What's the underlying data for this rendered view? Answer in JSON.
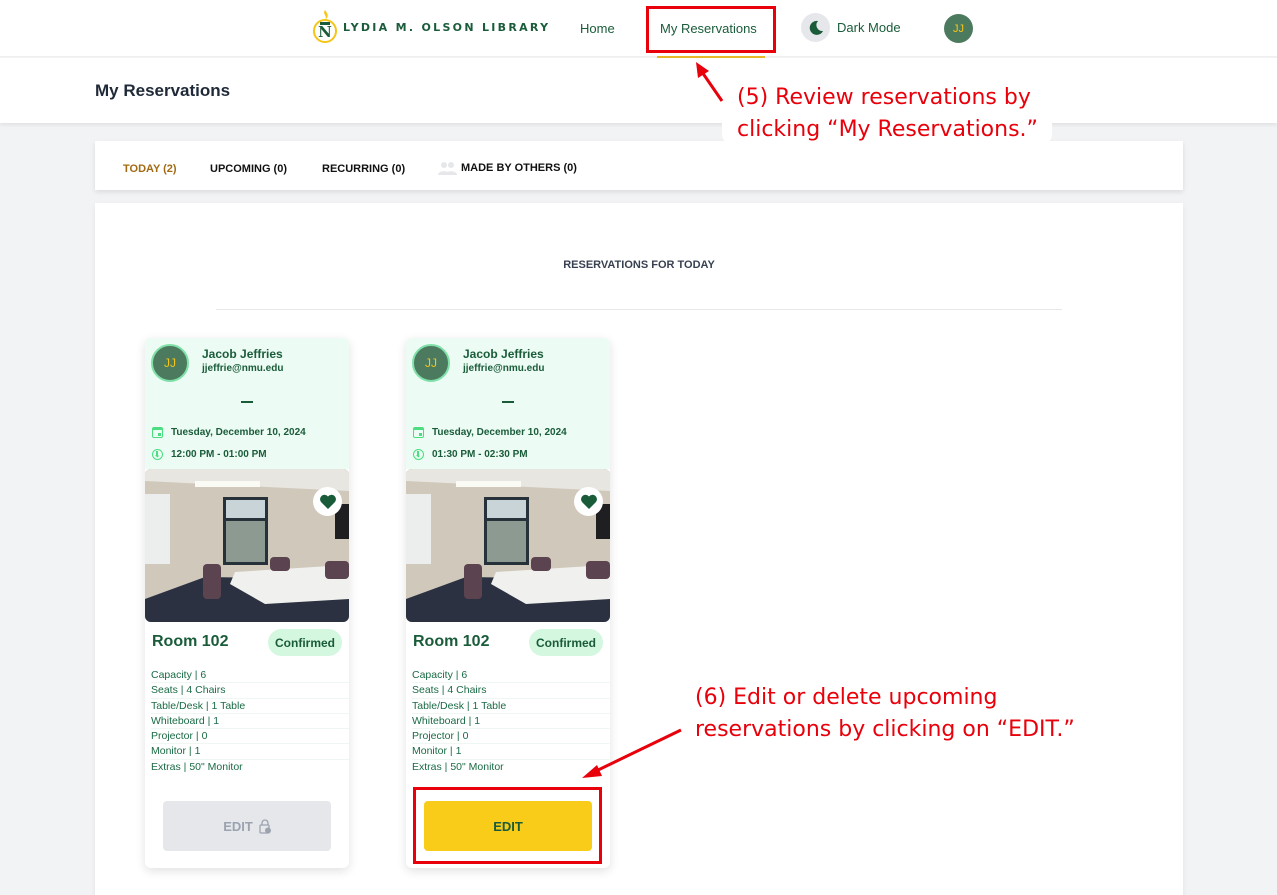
{
  "nav": {
    "logo_text": "LYDIA M. OLSON LIBRARY",
    "logo_icon": "nmu-torch-logo-icon",
    "home_label": "Home",
    "my_reservations_label": "My Reservations",
    "dark_mode_label": "Dark Mode",
    "dark_mode_icon": "moon-icon",
    "user_initials": "JJ"
  },
  "page": {
    "title": "My Reservations"
  },
  "tabs": [
    {
      "label": "TODAY (2)",
      "active": true
    },
    {
      "label": "UPCOMING (0)",
      "active": false
    },
    {
      "label": "RECURRING (0)",
      "active": false
    },
    {
      "label": "MADE BY OTHERS (0)",
      "active": false,
      "icon": "people-icon"
    }
  ],
  "section": {
    "title": "RESERVATIONS FOR TODAY"
  },
  "reservations": [
    {
      "initials": "JJ",
      "name": "Jacob Jeffries",
      "email": "jjeffrie@nmu.edu",
      "date": "Tuesday, December 10, 2024",
      "time": "12:00 PM - 01:00 PM",
      "room": "Room 102",
      "status": "Confirmed",
      "specs": [
        "Capacity | 6",
        "Seats | 4 Chairs",
        "Table/Desk | 1 Table",
        "Whiteboard | 1",
        "Projector | 0",
        "Monitor | 1",
        "Extras | 50\" Monitor"
      ],
      "edit_label": "EDIT",
      "edit_enabled": false,
      "edit_icon": "lock-clock-icon"
    },
    {
      "initials": "JJ",
      "name": "Jacob Jeffries",
      "email": "jjeffrie@nmu.edu",
      "date": "Tuesday, December 10, 2024",
      "time": "01:30 PM - 02:30 PM",
      "room": "Room 102",
      "status": "Confirmed",
      "specs": [
        "Capacity | 6",
        "Seats | 4 Chairs",
        "Table/Desk | 1 Table",
        "Whiteboard | 1",
        "Projector | 0",
        "Monitor | 1",
        "Extras | 50\" Monitor"
      ],
      "edit_label": "EDIT",
      "edit_enabled": true
    }
  ],
  "annotations": {
    "step5_line1": "(5) Review reservations by",
    "step5_line2": "clicking “My Reservations.”",
    "step6_line1": "(6) Edit or delete upcoming",
    "step6_line2": "reservations by clicking on “EDIT.”",
    "color": "#e8000b"
  },
  "colors": {
    "brand_green": "#1a5c3a",
    "accent_gold": "#f8cc18",
    "tab_active": "#a26a12",
    "card_header_bg": "#ecfbf3",
    "status_bg": "#d4f7e0"
  }
}
